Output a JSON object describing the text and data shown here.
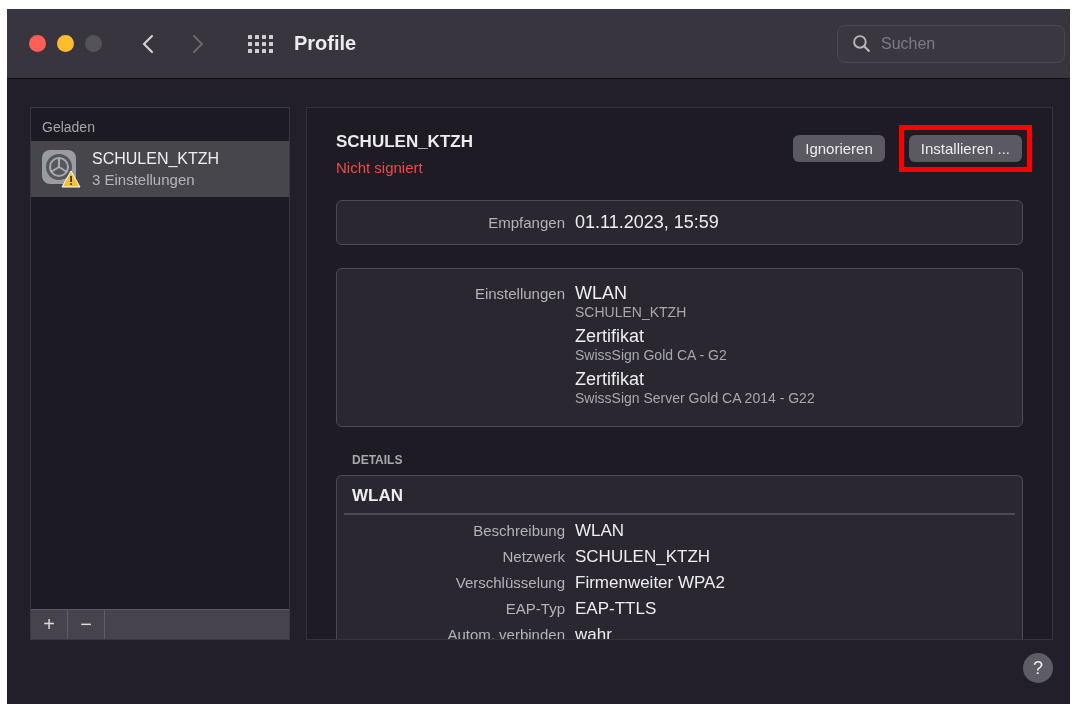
{
  "window": {
    "title": "Profile"
  },
  "nav": [
    {
      "kind": "back",
      "disabled": false
    },
    {
      "kind": "forward",
      "disabled": true
    }
  ],
  "search": {
    "placeholder": "Suchen"
  },
  "sidebar": {
    "heading": "Geladen",
    "items": [
      {
        "name": "SCHULEN_KTZH",
        "subtitle": "3 Einstellungen",
        "selected": true
      }
    ],
    "toolbar": [
      "+",
      "−"
    ]
  },
  "profile": {
    "name": "SCHULEN_KTZH",
    "status": "Nicht signiert",
    "buttons": [
      {
        "label": "Ignorieren",
        "highlighted": false
      },
      {
        "label": "Installieren ...",
        "highlighted": true
      }
    ],
    "received": {
      "label": "Empfangen",
      "value": "01.11.2023, 15:59"
    },
    "settings": {
      "label": "Einstellungen",
      "items": [
        {
          "title": "WLAN",
          "subtitle": "SCHULEN_KTZH"
        },
        {
          "title": "Zertifikat",
          "subtitle": "SwissSign Gold CA - G2"
        },
        {
          "title": "Zertifikat",
          "subtitle": "SwissSign Server Gold CA 2014 - G22"
        }
      ]
    },
    "details": {
      "heading": "DETAILS",
      "sections": [
        {
          "title": "WLAN",
          "rows": [
            {
              "label": "Beschreibung",
              "value": "WLAN"
            },
            {
              "label": "Netzwerk",
              "value": "SCHULEN_KTZH"
            },
            {
              "label": "Verschlüsselung",
              "value": "Firmenweiter WPA2"
            },
            {
              "label": "EAP-Typ",
              "value": "EAP-TTLS"
            },
            {
              "label": "Autom. verbinden",
              "value": "wahr"
            }
          ]
        }
      ]
    }
  },
  "help": "?"
}
